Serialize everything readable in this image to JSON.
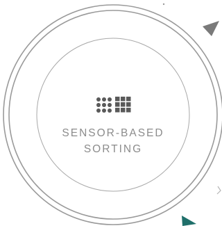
{
  "badge": {
    "line1": "SENSOR-BASED",
    "line2": "SORTING",
    "text_color": "#8c8c8c",
    "ring_color": "#9a9a9a",
    "icon_color": "#5a5a5a"
  },
  "icons": {
    "dots": "dot-grid-icon",
    "squares": "square-grid-icon"
  },
  "arrows": {
    "top_right_color": "#7a7a7a",
    "bottom_right_color": "#1f6f6a",
    "faint_color": "#b5b5b5"
  }
}
